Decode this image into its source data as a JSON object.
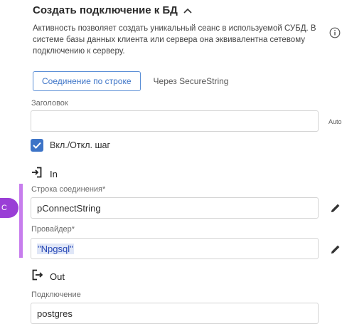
{
  "header": {
    "title": "Создать подключение к БД",
    "collapse_icon": "chevron-up-icon"
  },
  "description": "Активность позволяет создать уникальный сеанс в используемой СУБД. В системе базы данных клиента или сервера она эквивалентна сетевому подключению к серверу.",
  "info_icon": "info-icon",
  "tabs": [
    {
      "label": "Соединение по строке",
      "active": true
    },
    {
      "label": "Через SecureString",
      "active": false
    }
  ],
  "title_field": {
    "label": "Заголовок",
    "value": "",
    "side_text": "Auto"
  },
  "step_toggle": {
    "label": "Вкл./Откл. шаг",
    "checked": true
  },
  "in_section": {
    "label": "In",
    "icon": "sign-in-icon"
  },
  "connection_string": {
    "label": "Строка соединения*",
    "value": "pConnectString",
    "edit_icon": "pencil-icon"
  },
  "provider": {
    "label": "Провайдер*",
    "value": "\"Npgsql\"",
    "edit_icon": "pencil-icon"
  },
  "out_section": {
    "label": "Out",
    "icon": "sign-out-icon"
  },
  "connection": {
    "label": "Подключение",
    "value": "postgres"
  },
  "side_badge": {
    "text": "C",
    "color": "#9a3ed6"
  },
  "colors": {
    "accent": "#3d74c7",
    "highlight_bar": "#c77ded"
  }
}
